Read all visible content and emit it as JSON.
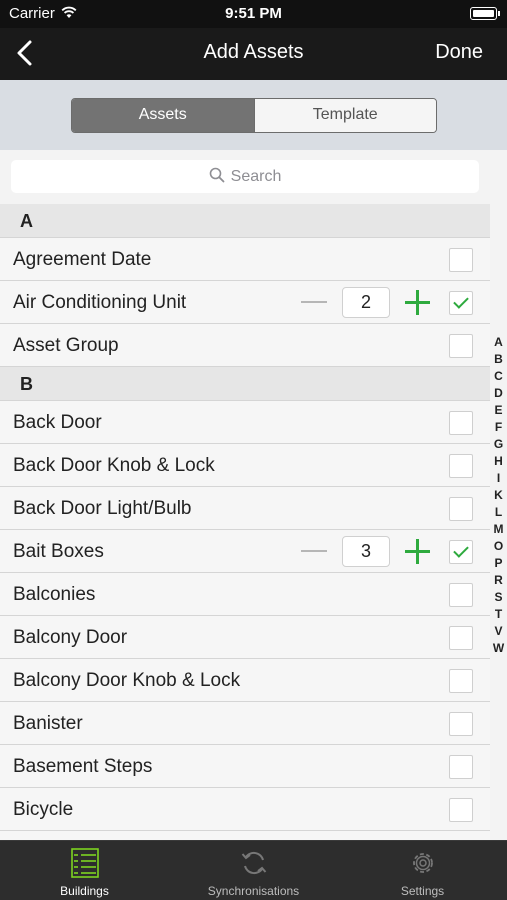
{
  "status_bar": {
    "carrier": "Carrier",
    "time": "9:51 PM"
  },
  "nav": {
    "title": "Add Assets",
    "done_label": "Done"
  },
  "segments": [
    {
      "label": "Assets",
      "active": true
    },
    {
      "label": "Template",
      "active": false
    }
  ],
  "search": {
    "placeholder": "Search"
  },
  "sections": [
    {
      "letter": "A",
      "items": [
        {
          "label": "Agreement Date",
          "checked": false
        },
        {
          "label": "Air Conditioning Unit",
          "checked": true,
          "quantity": "2"
        },
        {
          "label": "Asset Group",
          "checked": false
        }
      ]
    },
    {
      "letter": "B",
      "items": [
        {
          "label": "Back Door",
          "checked": false
        },
        {
          "label": "Back Door Knob & Lock",
          "checked": false
        },
        {
          "label": "Back Door Light/Bulb",
          "checked": false
        },
        {
          "label": "Bait Boxes",
          "checked": true,
          "quantity": "3"
        },
        {
          "label": "Balconies",
          "checked": false
        },
        {
          "label": "Balcony Door",
          "checked": false
        },
        {
          "label": "Balcony Door Knob & Lock",
          "checked": false
        },
        {
          "label": "Banister",
          "checked": false
        },
        {
          "label": "Basement Steps",
          "checked": false
        },
        {
          "label": "Bicycle",
          "checked": false
        },
        {
          "label": "",
          "checked": false
        }
      ]
    }
  ],
  "index_letters": [
    "A",
    "B",
    "C",
    "D",
    "E",
    "F",
    "G",
    "H",
    "I",
    "K",
    "L",
    "M",
    "O",
    "P",
    "R",
    "S",
    "T",
    "V",
    "W"
  ],
  "tabs": [
    {
      "label": "Buildings",
      "icon": "buildings-icon",
      "active": true
    },
    {
      "label": "Synchronisations",
      "icon": "sync-icon",
      "active": false
    },
    {
      "label": "Settings",
      "icon": "gear-icon",
      "active": false
    }
  ],
  "colors": {
    "accent_green": "#2eaa3e",
    "nav_bg": "#1a1a1a",
    "segment_active": "#737373",
    "tab_active_icon": "#7dd321"
  }
}
